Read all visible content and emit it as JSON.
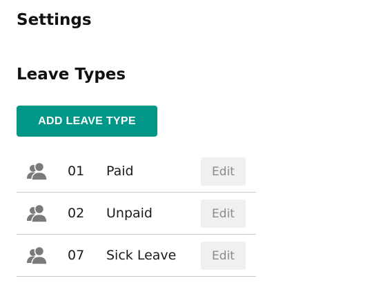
{
  "page": {
    "title": "Settings"
  },
  "leave_types": {
    "heading": "Leave Types",
    "add_button_label": "ADD LEAVE TYPE",
    "items": [
      {
        "icon": "users-icon",
        "code": "01",
        "name": "Paid",
        "edit_label": "Edit"
      },
      {
        "icon": "users-icon",
        "code": "02",
        "name": "Unpaid",
        "edit_label": "Edit"
      },
      {
        "icon": "users-icon",
        "code": "07",
        "name": "Sick Leave",
        "edit_label": "Edit"
      }
    ]
  },
  "colors": {
    "accent": "#009688",
    "icon": "#7a7a7a",
    "edit_button_bg": "#f0f0f0",
    "edit_button_text": "#8a8a8a"
  }
}
